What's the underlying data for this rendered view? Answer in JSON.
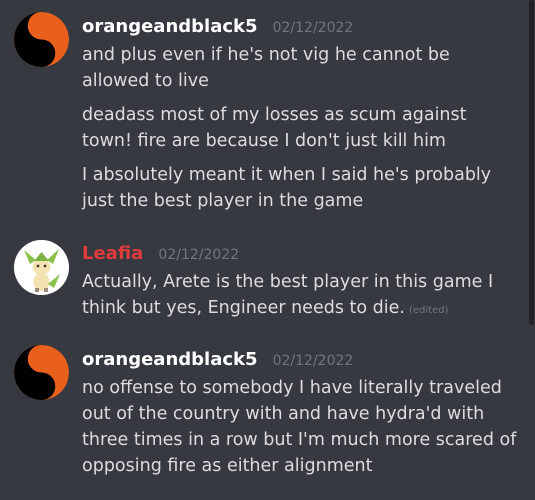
{
  "messages": [
    {
      "username": "orangeandblack5",
      "username_color": "#ffffff",
      "timestamp": "02/12/2022",
      "lines": [
        "and plus even if he's not vig he cannot be allowed to live",
        "deadass most of my losses as scum against town! fire are because I don't just kill him",
        "I absolutely meant it when I said he's probably just the best player in the game"
      ]
    },
    {
      "username": "Leafia",
      "username_color": "#e03c3c",
      "timestamp": "02/12/2022",
      "lines": [
        "Actually, Arete is the best player in this game I think but yes, Engineer needs to die."
      ],
      "edited_label": "(edited)"
    },
    {
      "username": "orangeandblack5",
      "username_color": "#ffffff",
      "timestamp": "02/12/2022",
      "lines": [
        "no offense to somebody I have literally traveled out of the country with and have hydra'd with three times in a row but I'm much more scared of opposing fire as either alignment"
      ]
    }
  ],
  "icons": {
    "avatar_1": "yin-yang-orange-icon",
    "avatar_2": "leafeon-avatar-icon",
    "avatar_3": "yin-yang-orange-icon"
  },
  "colors": {
    "background": "#36393f",
    "text": "#dcddde",
    "timestamp": "#72767d",
    "yin_yang_orange": "#e8601c",
    "leafia": "#e03c3c"
  }
}
